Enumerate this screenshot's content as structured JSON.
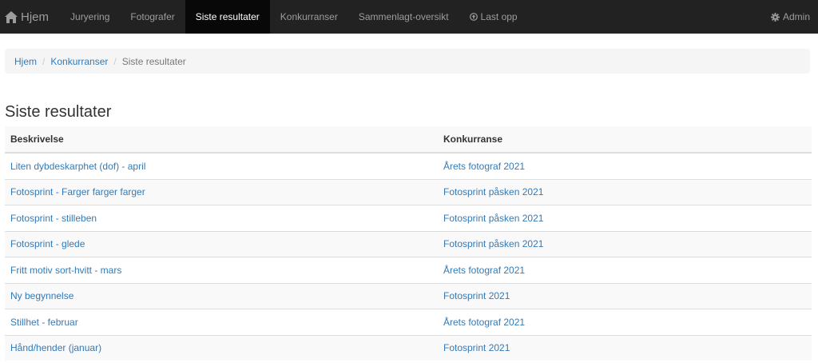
{
  "navbar": {
    "brand": "Hjem",
    "items": [
      {
        "label": "Juryering",
        "active": false
      },
      {
        "label": "Fotografer",
        "active": false
      },
      {
        "label": "Siste resultater",
        "active": true
      },
      {
        "label": "Konkurranser",
        "active": false
      },
      {
        "label": "Sammenlagt-oversikt",
        "active": false
      },
      {
        "label": "Last opp",
        "active": false,
        "icon": "upload-icon"
      }
    ],
    "admin": "Admin",
    "admin_icon": "gear-icon",
    "brand_icon": "home-icon"
  },
  "breadcrumb": {
    "items": [
      "Hjem",
      "Konkurranser"
    ],
    "current": "Siste resultater"
  },
  "page_title": "Siste resultater",
  "table": {
    "headers": [
      "Beskrivelse",
      "Konkurranse"
    ],
    "rows": [
      [
        "Liten dybdeskarphet (dof) - april",
        "Årets fotograf 2021"
      ],
      [
        "Fotosprint - Farger farger farger",
        "Fotosprint påsken 2021"
      ],
      [
        "Fotosprint - stilleben",
        "Fotosprint påsken 2021"
      ],
      [
        "Fotosprint - glede",
        "Fotosprint påsken 2021"
      ],
      [
        "Fritt motiv sort-hvitt - mars",
        "Årets fotograf 2021"
      ],
      [
        "Ny begynnelse",
        "Fotosprint 2021"
      ],
      [
        "Stillhet - februar",
        "Årets fotograf 2021"
      ],
      [
        "Hånd/hender (januar)",
        "Fotosprint 2021"
      ]
    ]
  },
  "colors": {
    "navbar_bg": "#222222",
    "navbar_active_bg": "#080808",
    "link": "#337ab7"
  }
}
